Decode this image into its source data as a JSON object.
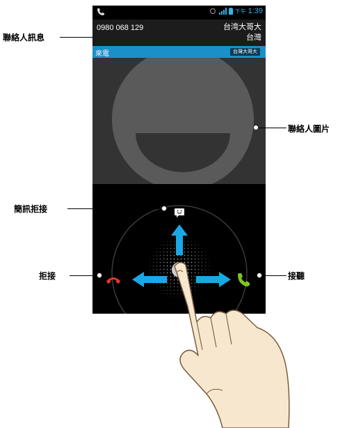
{
  "status_bar": {
    "ampm": "下午",
    "time": "1:39",
    "icons": [
      "phone-icon",
      "sync-icon",
      "signal-icon",
      "battery-icon"
    ]
  },
  "contact": {
    "number": "0980 068 129",
    "carrier_line1": "台湾大哥大",
    "carrier_line2": "台灣"
  },
  "incoming": {
    "label": "來電",
    "tag": "台灣大哥大"
  },
  "annotations": {
    "contact_info": "聯絡人訊息",
    "contact_photo": "聯絡人圖片",
    "sms_reject": "簡訊拒接",
    "reject": "拒接",
    "answer": "接聽"
  },
  "colors": {
    "accent_blue": "#1b8fc8",
    "arrow_blue": "#1aa7e6",
    "reject_red": "#e8342c",
    "answer_green": "#7fc41e"
  }
}
